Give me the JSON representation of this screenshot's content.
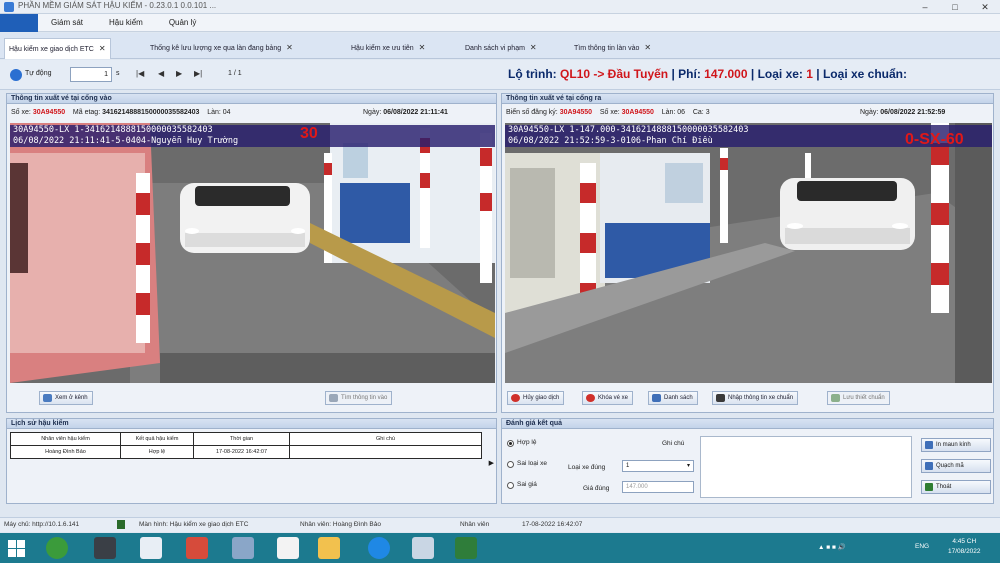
{
  "window": {
    "title": "PHẦN MỀM GIÁM SÁT HẬU KIỂM - 0.23.0.1 0.0.101 ..."
  },
  "menu": {
    "items": [
      "Giám sát",
      "Hậu kiểm",
      "Quản lý"
    ]
  },
  "tabs": [
    {
      "label": "Hậu kiểm xe giao dịch ETC"
    },
    {
      "label": "Thống kê lưu lượng xe qua làn đang bảng"
    },
    {
      "label": "Hậu kiểm xe ưu tiên"
    },
    {
      "label": "Danh sách vi phạm"
    },
    {
      "label": "Tìm thông tin làn vào"
    }
  ],
  "toolbar": {
    "auto_label": "Tự động",
    "page_size": "1",
    "page_size_unit": "s",
    "page_info": "1 / 1",
    "route_prefix": "Lộ trình: ",
    "route_value": "QL10 -> Đầu Tuyến",
    "fee_prefix": " | Phí: ",
    "fee_value": "147.000",
    "vehicle_type_prefix": " | Loại xe: ",
    "vehicle_type_value": "1",
    "standard_suffix": " | Loại xe chuẩn:"
  },
  "entry": {
    "title": "Thông tin xuất vé tại cổng vào",
    "plate_label": "Số xe:",
    "plate": "30A94550",
    "etag_label": "Mã etag:",
    "etag": "3416214888150000035582403",
    "lane_label": "Làn: 04",
    "date_label": "Ngày:",
    "date": "06/08/2022 21:11:41",
    "overlay_line1": "30A94550-LX  1-3416214888150000035582403",
    "overlay_line2": "06/08/2022 21:11:41-5-0404-Nguyễn Huy Trường",
    "overlay_plate": "30",
    "btn_view": "Xem ở kênh",
    "btn_find": "Tìm thông tin vào"
  },
  "exit": {
    "title": "Thông tin xuất vé tại cổng ra",
    "etc_label": "Biển số đăng ký:",
    "etc_plate": "30A94550",
    "plate_label": "Số xe:",
    "plate": "30A94550",
    "lane_label": "Làn: 06",
    "shift_label": "Ca: 3",
    "date_label": "Ngày:",
    "date": "06/08/2022 21:52:59",
    "overlay_line1": "30A94550-LX  1-147.000-3416214888150000035582403",
    "overlay_line2": "06/08/2022 21:52:59-3-0106-Phan Chí Điều",
    "overlay_plate": "0-SX-60",
    "buttons": [
      "Hủy giao dịch",
      "Khóa vé xe",
      "Danh sách",
      "Nhập thông tin xe chuẩn",
      "Lưu thiết chuẩn"
    ]
  },
  "history": {
    "title": "Lịch sử hậu kiểm",
    "headers": [
      "Nhân viên hậu kiểm",
      "Kết quả hậu kiểm",
      "Thời gian",
      "Ghi chú"
    ],
    "rows": [
      [
        "Hoàng Đình Bảo",
        "Hợp lệ",
        "17-08-2022 16:42:07",
        ""
      ]
    ]
  },
  "evaluation": {
    "title": "Đánh giá kết quả",
    "opt_valid": "Hợp lệ",
    "opt_wrong_type": "Sai loại xe",
    "opt_wrong_price": "Sai giá",
    "note_label": "Ghi chú",
    "correct_type_label": "Loại xe đúng",
    "correct_type_value": "1",
    "correct_price_label": "Giá đúng",
    "correct_price_value": "147.000",
    "actions": [
      "In maun kính",
      "Quạch mã",
      "Thoát"
    ]
  },
  "statusbar": {
    "server": "Máy chủ: http://10.1.6.141",
    "function": "Màn hình: Hậu kiểm xe giao dịch ETC",
    "staff": "Nhân viên: Hoàng Đình Bảo",
    "staff2": "Nhân viên",
    "time": "17-08-2022 16:42:07"
  },
  "taskbar": {
    "lang": "ENG",
    "time": "4:45 CH",
    "date": "17/08/2022"
  },
  "colors": {
    "accent": "#1f5fb8",
    "alert_red": "#d0161b",
    "taskbar": "#1c7a8f"
  }
}
